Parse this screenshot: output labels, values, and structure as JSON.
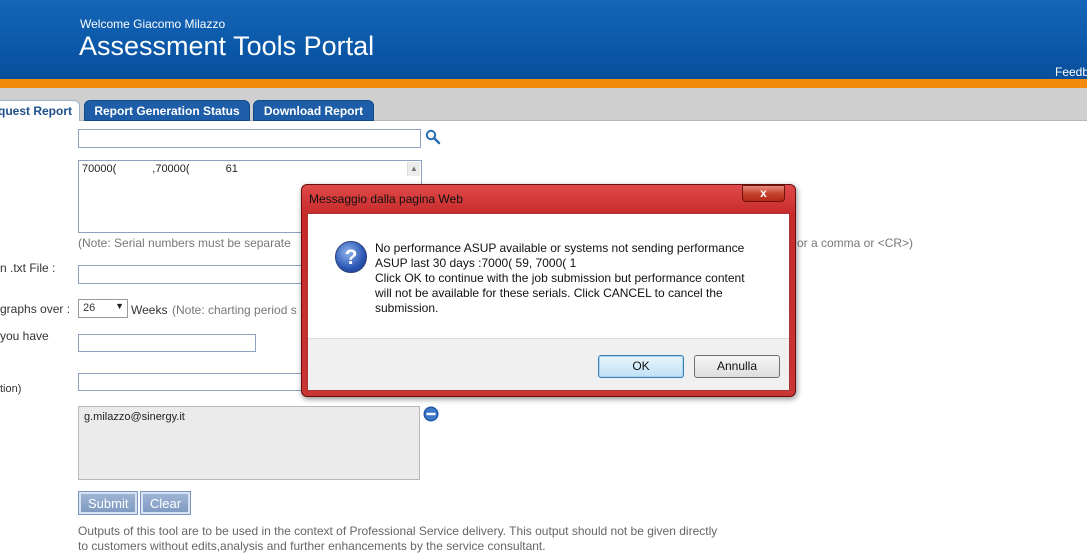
{
  "header": {
    "welcome": "Welcome Giacomo Milazzo",
    "title": "Assessment Tools Portal",
    "feedback": "Feedback"
  },
  "tabs": [
    {
      "label": "Request Report",
      "display": "quest Report",
      "active": true
    },
    {
      "label": "Report Generation Status",
      "active": false
    },
    {
      "label": "Download Report",
      "active": false
    }
  ],
  "form": {
    "serials_value_start": "70000(",
    "serials_value_mid": ",70000(",
    "serials_value_end": "61",
    "serial_note": "(Note: Serial numbers must be separate",
    "serial_note_tail": "or a comma or <CR>)",
    "txt_file_label": "n .txt File :",
    "graphs_label": "graphs over :",
    "weeks_value": "26",
    "weeks_label": "Weeks",
    "weeks_note": "(Note: charting period s",
    "you_have_label": "you have",
    "tion_label": "tion)",
    "email_value": "g.milazzo@sinergy.it",
    "submit_label": "Submit",
    "clear_label": "Clear",
    "footer_line1": "Outputs of this tool are to be used in the context of Professional Service delivery. This output should not be given directly",
    "footer_line2": "to customers without edits,analysis and further enhancements by the service consultant."
  },
  "dialog": {
    "title": "Messaggio dalla pagina Web",
    "close": "x",
    "message": "No performance ASUP available or systems not sending performance\nASUP last 30 days :7000(        59, 7000(        1\nClick OK to continue with the job submission but performance content\nwill not be available for these serials. Click CANCEL to cancel the\nsubmission.",
    "ok_label": "OK",
    "cancel_label": "Annulla",
    "icon": "question-icon"
  },
  "colors": {
    "header_blue": "#0b58a8",
    "orange_bar": "#f28a0d",
    "tab_blue": "#1e5ea8",
    "dialog_red": "#c82a2a"
  }
}
